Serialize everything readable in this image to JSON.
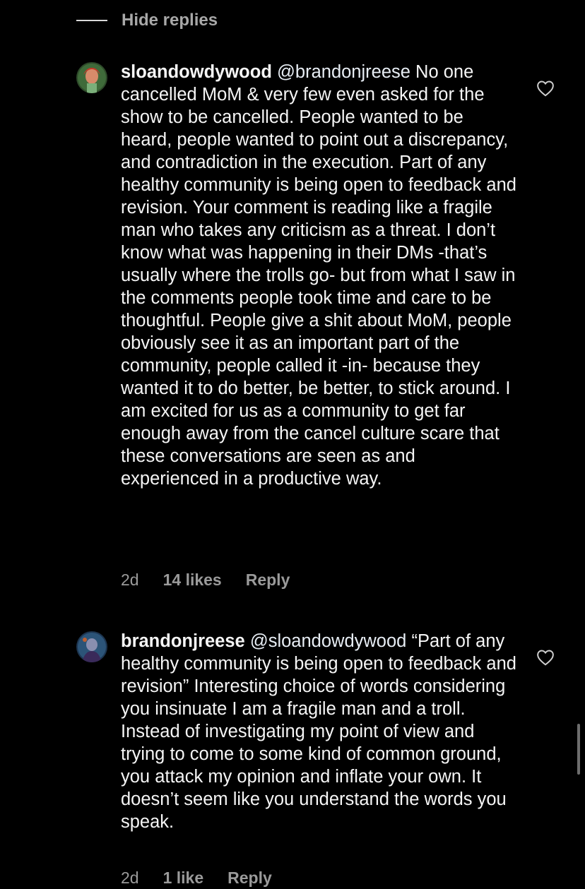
{
  "thread": {
    "hide_replies_label": "Hide replies"
  },
  "comments": [
    {
      "username": "sloandowdywood",
      "mention": "@brandonjreese",
      "body": "No one cancelled MoM & very few even asked for the show to be cancelled. People wanted to be heard, people wanted to point out a discrepancy, and contradiction in the execution. Part of any healthy community is being open to feedback and revision. Your comment is reading like a fragile man who takes any criticism as a threat. I don’t know what was happening in their DMs -that’s usually where the trolls go- but from what I saw in the comments people took time and care to be thoughtful. People give a shit about MoM, people obviously see it as an important part of the community, people called it -in- because they wanted it to do better, be better, to stick around. I am excited for us as a community to get far enough away from the cancel culture scare that these conversations are seen as and experienced in a productive way.",
      "time": "2d",
      "likes": "14 likes",
      "reply_label": "Reply",
      "avatar_icon": "user-avatar-icon"
    },
    {
      "username": "brandonjreese",
      "mention": "@sloandowdywood",
      "body": "“Part of any healthy community is being open to feedback and revision” Interesting choice of words considering you insinuate I am a fragile man and a troll. Instead of investigating my point of view and trying to come to some kind of common ground, you attack my opinion and inflate your own. It doesn’t seem like you understand the words you speak.",
      "time": "2d",
      "likes": "1 like",
      "reply_label": "Reply",
      "avatar_icon": "user-avatar-icon"
    }
  ],
  "icons": {
    "like": "heart-outline-icon"
  },
  "colors": {
    "background": "#000000",
    "text": "#f5f5f5",
    "muted": "#9a9a9a"
  }
}
